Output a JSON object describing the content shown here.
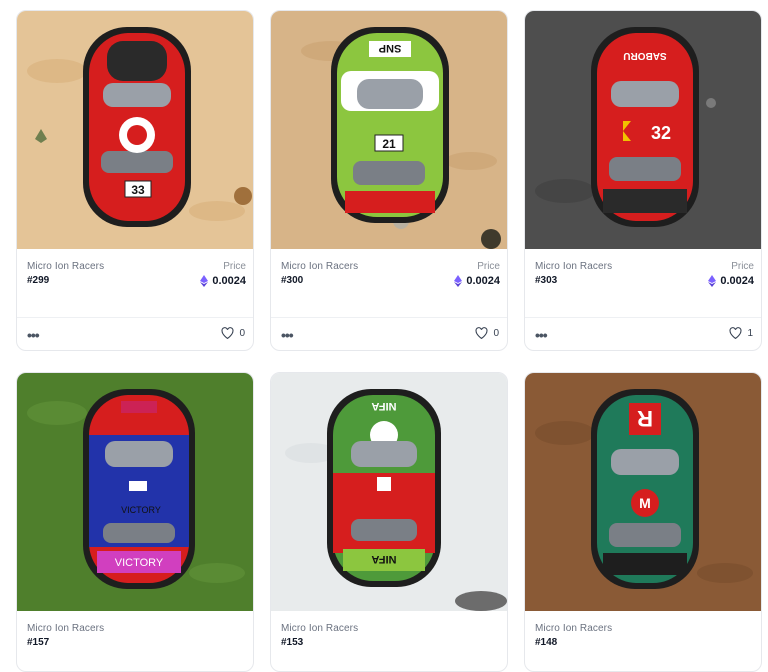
{
  "cards": [
    {
      "collection": "Micro Ion Racers",
      "token": "#299",
      "price_label": "Price",
      "price": "0.0024",
      "likes": "0",
      "bg": "#e4c497",
      "car_body": "#d61e1e",
      "car_number": "33"
    },
    {
      "collection": "Micro Ion Racers",
      "token": "#300",
      "price_label": "Price",
      "price": "0.0024",
      "likes": "0",
      "bg": "#d7b488",
      "car_body": "#8cc63f",
      "car_number": "21",
      "car_text": "SNP"
    },
    {
      "collection": "Micro Ion Racers",
      "token": "#303",
      "price_label": "Price",
      "price": "0.0024",
      "likes": "1",
      "bg": "#4e4e4e",
      "car_body": "#d61e1e",
      "car_number": "32",
      "car_text": "SABORU"
    },
    {
      "collection": "Micro Ion Racers",
      "token": "#157",
      "bg": "#4f7f2c",
      "car_body": "#2233aa",
      "car_text": "VICTORY"
    },
    {
      "collection": "Micro Ion Racers",
      "token": "#153",
      "bg": "#e8ebec",
      "car_body": "#4e9a3a",
      "car_text": "NIFA"
    },
    {
      "collection": "Micro Ion Racers",
      "token": "#148",
      "bg": "#8a5a36",
      "car_body": "#1f7a5a",
      "car_letter": "R",
      "car_badge": "M"
    }
  ],
  "icons": {
    "menu": "more-dots-icon",
    "like": "heart-icon",
    "currency": "ethereum-icon"
  },
  "colors": {
    "accent_eth": "#7b61ff",
    "border": "#e6e8ec"
  }
}
